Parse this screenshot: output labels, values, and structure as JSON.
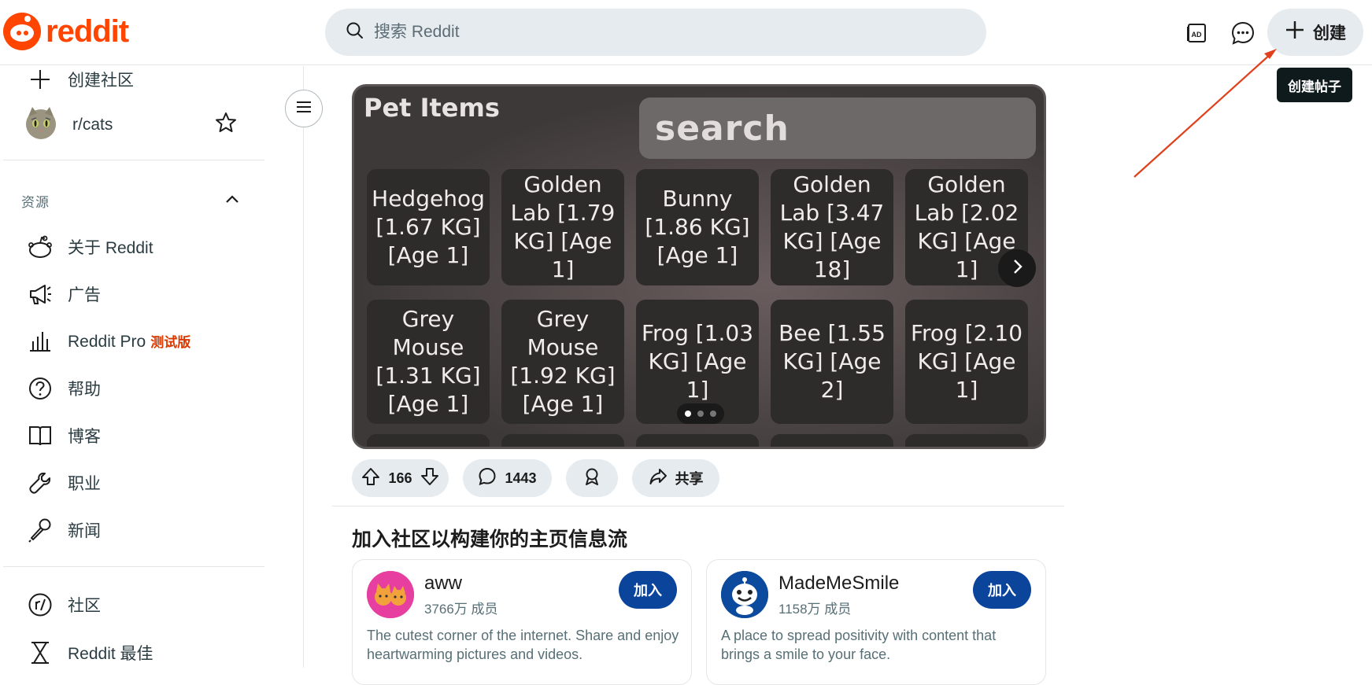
{
  "header": {
    "logo_text": "reddit",
    "search_placeholder": "搜索 Reddit",
    "create_label": "创建",
    "tooltip": "创建帖子"
  },
  "sidebar": {
    "create_community": "创建社区",
    "subreddit": "r/cats",
    "resources_label": "资源",
    "items": [
      {
        "label": "关于 Reddit",
        "icon": "reddit-alien-icon"
      },
      {
        "label": "广告",
        "icon": "megaphone-icon"
      },
      {
        "label": "Reddit Pro",
        "badge": "测试版",
        "icon": "chart-icon"
      },
      {
        "label": "帮助",
        "icon": "help-icon"
      },
      {
        "label": "博客",
        "icon": "book-icon"
      },
      {
        "label": "职业",
        "icon": "wrench-icon"
      },
      {
        "label": "新闻",
        "icon": "microphone-icon"
      }
    ],
    "bottom_items": [
      {
        "label": "社区",
        "icon": "communities-icon"
      },
      {
        "label": "Reddit 最佳",
        "icon": "hourglass-icon"
      }
    ]
  },
  "post": {
    "image_title": "Pet Items",
    "image_search": "search",
    "tiles": [
      "Hedgehog [1.67 KG] [Age 1]",
      "Golden Lab [1.79 KG] [Age 1]",
      "Bunny [1.86 KG] [Age 1]",
      "Golden Lab [3.47 KG] [Age 18]",
      "Golden Lab [2.02 KG] [Age 1]",
      "Grey Mouse [1.31 KG] [Age 1]",
      "Grey Mouse [1.92 KG] [Age 1]",
      "Frog [1.03 KG] [Age 1]",
      "Bee [1.55 KG] [Age 2]",
      "Frog [2.10 KG] [Age 1]"
    ],
    "carousel_pages": 3,
    "carousel_active": 1,
    "votes": "166",
    "comments": "1443",
    "share_label": "共享"
  },
  "suggestions": {
    "title": "加入社区以构建你的主页信息流",
    "join_label": "加入",
    "cards": [
      {
        "name": "aww",
        "members": "3766万 成员",
        "desc": "The cutest corner of the internet. Share and enjoy heartwarming pictures and videos."
      },
      {
        "name": "MadeMeSmile",
        "members": "1158万 成员",
        "desc": "A place to spread positivity with content that brings a smile to your face."
      }
    ]
  },
  "colors": {
    "brand": "#ff4500",
    "join_button": "#0a449b",
    "annotation_arrow": "#e0401c"
  }
}
